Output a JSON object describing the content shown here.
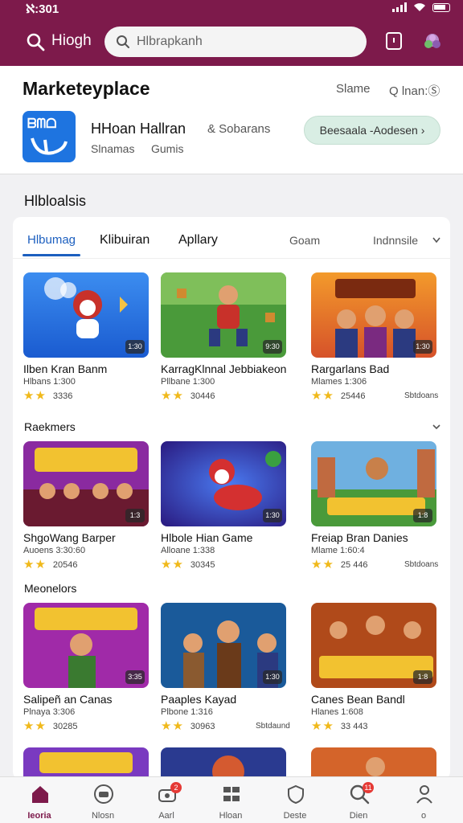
{
  "status_bar": {
    "time": "ℵ:301"
  },
  "top_bar": {
    "title": "Hiogh",
    "search_placeholder": "Hlbrapkanh"
  },
  "header": {
    "page_title": "Marketeyplace",
    "link1": "Slame",
    "link2": "Q lnan:Ⓢ",
    "app": {
      "icon_text": "ᗷᗰᗝ",
      "name": "HHoan Hallran",
      "link": "& Sobarans",
      "sub1": "Slnamas",
      "sub2": "Gumis"
    },
    "primary_button": "Beesaala -Aodesen ›"
  },
  "section_title": "Hlbloalsis",
  "tabs": {
    "items": [
      "Hlbumag",
      "Klibuiran",
      "Apllary"
    ],
    "right1": "Goam",
    "right2": "Indnnsile"
  },
  "subsections": [
    "Raekmers",
    "Meonelors"
  ],
  "colors": {
    "brand": "#7d1a4b",
    "accent_tab": "#1c5fbf",
    "star": "#f0b91b"
  },
  "games": [
    {
      "name": "Ilben Kran Banm",
      "sub": "Hlbans 1:300",
      "rating": "3336",
      "badge": "1:30",
      "extra": ""
    },
    {
      "name": "KarragKlnnal Jebbiakeon",
      "sub": "Pllbane 1:300",
      "rating": "30446",
      "badge": "9:30",
      "extra": ""
    },
    {
      "name": "Rargarlans Bad",
      "sub": "Mlames 1:306",
      "rating": "25446",
      "badge": "1:30",
      "extra": "Sbtdoans"
    },
    {
      "name": "ShgoWang Barper",
      "sub": "Auoens 3:30:60",
      "rating": "20546",
      "badge": "1:3",
      "extra": ""
    },
    {
      "name": "Hlbole Hian Game",
      "sub": "Alloane 1:338",
      "rating": "30345",
      "badge": "1:30",
      "extra": ""
    },
    {
      "name": "Freiap Bran Danies",
      "sub": "Mlame 1:60:4",
      "rating": "25 446",
      "badge": "1:8",
      "extra": "Sbtdoans"
    },
    {
      "name": "Salipeñ an Canas",
      "sub": "Plnaya 3:306",
      "rating": "30285",
      "badge": "3:35",
      "extra": ""
    },
    {
      "name": "Paaples Kayad",
      "sub": "Plbone 1:316",
      "rating": "30963",
      "badge": "1:30",
      "extra": "Sbtdaund"
    },
    {
      "name": "Canes Bean Bandl",
      "sub": "Hlanes 1:608",
      "rating": "33 443",
      "badge": "1:8",
      "extra": ""
    }
  ],
  "nav": [
    {
      "label": "Ieoria",
      "icon": "home-icon",
      "badge": ""
    },
    {
      "label": "Nlosn",
      "icon": "console-icon",
      "badge": ""
    },
    {
      "label": "Aarl",
      "icon": "gamepad-icon",
      "badge": "2"
    },
    {
      "label": "Hloan",
      "icon": "grid-icon",
      "badge": ""
    },
    {
      "label": "Deste",
      "icon": "shield-icon",
      "badge": ""
    },
    {
      "label": "Dien",
      "icon": "search-icon",
      "badge": "11"
    },
    {
      "label": "o",
      "icon": "profile-icon",
      "badge": ""
    }
  ]
}
